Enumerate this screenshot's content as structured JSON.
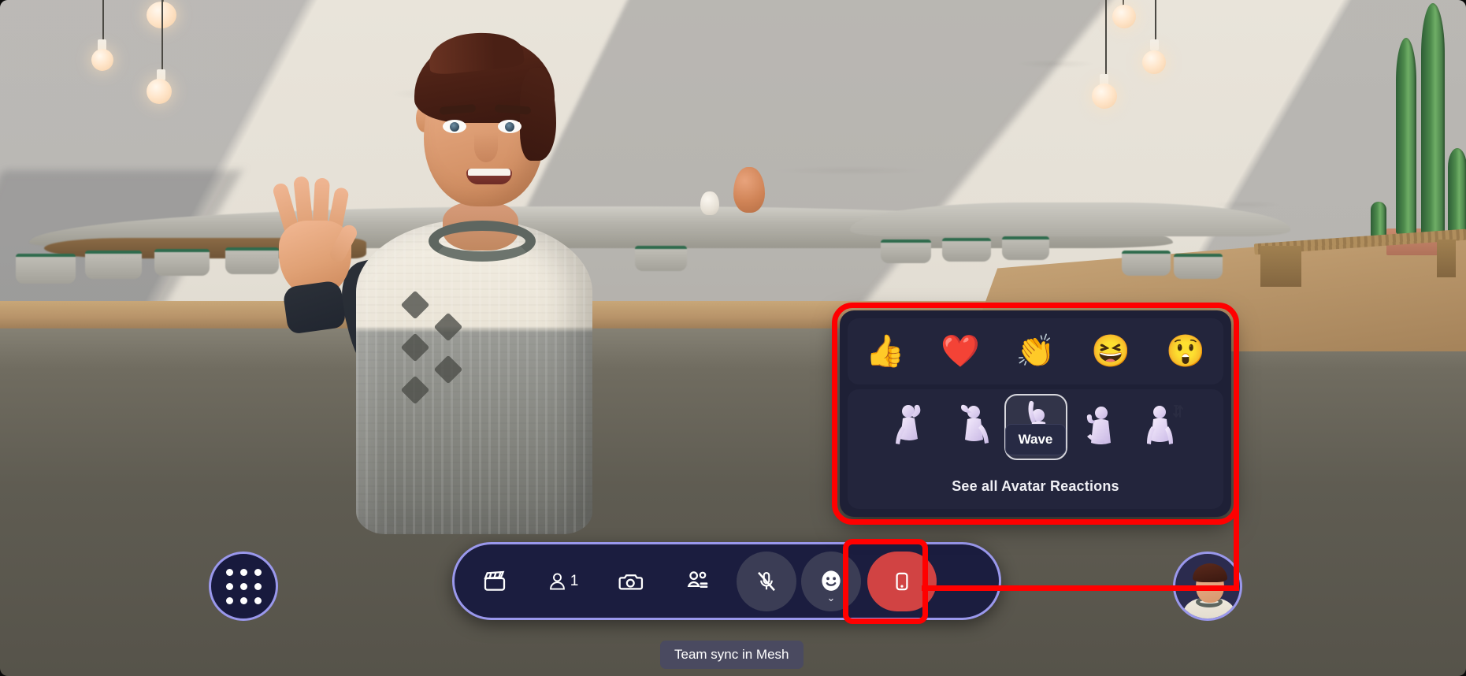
{
  "app": {
    "meeting_label": "Team sync in Mesh",
    "scene_name": "desert-patio-immersive-space"
  },
  "toolbar": {
    "app_grid": {
      "name": "app-grid-button",
      "icon": "grid-dots-icon"
    },
    "items": [
      {
        "id": "clips",
        "icon": "clapperboard-icon",
        "label": ""
      },
      {
        "id": "participants",
        "icon": "person-icon",
        "label": "1"
      },
      {
        "id": "camera",
        "icon": "camera-icon",
        "label": ""
      },
      {
        "id": "together",
        "icon": "together-mode-icon",
        "label": ""
      },
      {
        "id": "mic",
        "icon": "microphone-muted-icon",
        "label": ""
      },
      {
        "id": "reactions",
        "icon": "smiley-face-icon",
        "label": "",
        "chevron": "⌄"
      },
      {
        "id": "leave",
        "icon": "hangup-phone-icon",
        "label": ""
      }
    ],
    "self_view": {
      "name": "self-avatar-thumbnail"
    }
  },
  "reactions_panel": {
    "emoji_row": [
      {
        "id": "thumbs-up",
        "glyph": "👍",
        "icon": "thumbs-up-emoji"
      },
      {
        "id": "heart",
        "glyph": "❤️",
        "icon": "heart-emoji"
      },
      {
        "id": "applause",
        "glyph": "👏",
        "icon": "applause-emoji"
      },
      {
        "id": "laugh",
        "glyph": "😆",
        "icon": "laughing-emoji"
      },
      {
        "id": "surprised",
        "glyph": "😲",
        "icon": "surprised-emoji"
      }
    ],
    "gesture_row": [
      {
        "id": "flex",
        "icon": "avatar-flex-icon",
        "selected": false
      },
      {
        "id": "salute",
        "icon": "avatar-salute-icon",
        "selected": false
      },
      {
        "id": "wave",
        "icon": "avatar-wave-icon",
        "selected": true
      },
      {
        "id": "point",
        "icon": "avatar-point-icon",
        "selected": false
      },
      {
        "id": "raise",
        "icon": "avatar-raise-hand-icon",
        "selected": false
      }
    ],
    "tooltip": "Wave",
    "see_all_label": "See all Avatar Reactions"
  },
  "annotations": {
    "highlight_color": "#ff0000",
    "targets": [
      "reactions-panel",
      "reactions-toolbar-button"
    ]
  },
  "colors": {
    "accent_border": "#9a98ec",
    "toolbar_bg": "#1b1d3f",
    "panel_bg": "#1e2036",
    "panel_row_bg": "#23253c",
    "leave_red": "#d14343",
    "annotation_red": "#ff0000",
    "label_bg": "#4a4a60"
  }
}
